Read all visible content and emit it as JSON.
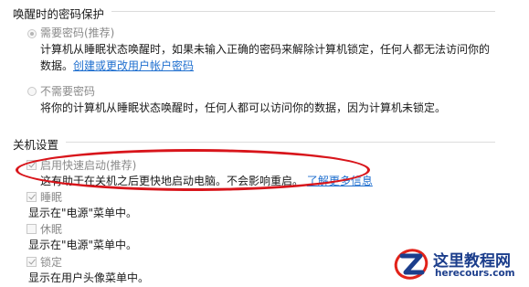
{
  "wake_section": {
    "title": "唤醒时的密码保护",
    "require_option": {
      "label": "需要密码(推荐)",
      "selected": true,
      "description_line1": "计算机从睡眠状态唤醒时，如果未输入正确的密码来解除计算机锁定，任何人都无法访问你的",
      "description_line2_prefix": "数据。",
      "link_text": "创建或更改用户帐户密码"
    },
    "no_require_option": {
      "label": "不需要密码",
      "selected": false,
      "description": "将你的计算机从睡眠状态唤醒时，任何人都可以访问你的数据，因为计算机未锁定。"
    }
  },
  "shutdown_section": {
    "title": "关机设置",
    "fast_startup": {
      "label": "启用快速启动(推荐)",
      "checked": true,
      "description": "这有助于在关机之后更快地启动电脑。不会影响重启。",
      "link_text": "了解更多信息"
    },
    "sleep": {
      "label": "睡眠",
      "checked": true,
      "description": "显示在\"电源\"菜单中。"
    },
    "hibernate": {
      "label": "休眠",
      "checked": false,
      "description": "显示在\"电源\"菜单中。"
    },
    "lock": {
      "label": "锁定",
      "checked": true,
      "description": "显示在用户头像菜单中。"
    }
  },
  "annotation": {
    "highlight_color": "#d8151b"
  },
  "watermark": {
    "title": "这里教程网",
    "url": "herecours.com",
    "brand_color": "#1c3e8c",
    "accent_color": "#e2231a"
  }
}
